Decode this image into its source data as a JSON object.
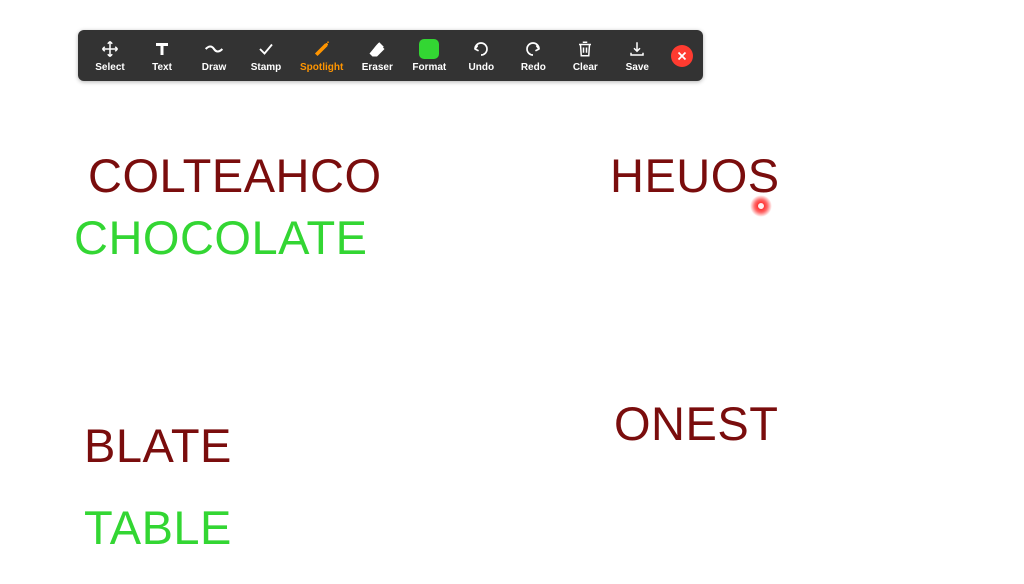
{
  "toolbar": {
    "tools": [
      {
        "name": "select",
        "label": "Select"
      },
      {
        "name": "text",
        "label": "Text"
      },
      {
        "name": "draw",
        "label": "Draw"
      },
      {
        "name": "stamp",
        "label": "Stamp"
      },
      {
        "name": "spotlight",
        "label": "Spotlight",
        "active": true
      },
      {
        "name": "eraser",
        "label": "Eraser"
      },
      {
        "name": "format",
        "label": "Format"
      },
      {
        "name": "undo",
        "label": "Undo"
      },
      {
        "name": "redo",
        "label": "Redo"
      },
      {
        "name": "clear",
        "label": "Clear"
      },
      {
        "name": "save",
        "label": "Save"
      }
    ],
    "format_color": "#33d633"
  },
  "canvas": {
    "words": [
      {
        "id": "w1",
        "text": "COLTEAHCO",
        "style": "scrambled"
      },
      {
        "id": "w2",
        "text": "CHOCOLATE",
        "style": "answer"
      },
      {
        "id": "w3",
        "text": "HEUOS",
        "style": "scrambled"
      },
      {
        "id": "w4",
        "text": "BLATE",
        "style": "scrambled"
      },
      {
        "id": "w5",
        "text": "TABLE",
        "style": "answer"
      },
      {
        "id": "w6",
        "text": "ONEST",
        "style": "scrambled"
      }
    ]
  },
  "colors": {
    "scrambled": "#7a0d0d",
    "answer": "#33d633",
    "toolbar_bg": "#333333",
    "active": "#ff9500"
  }
}
